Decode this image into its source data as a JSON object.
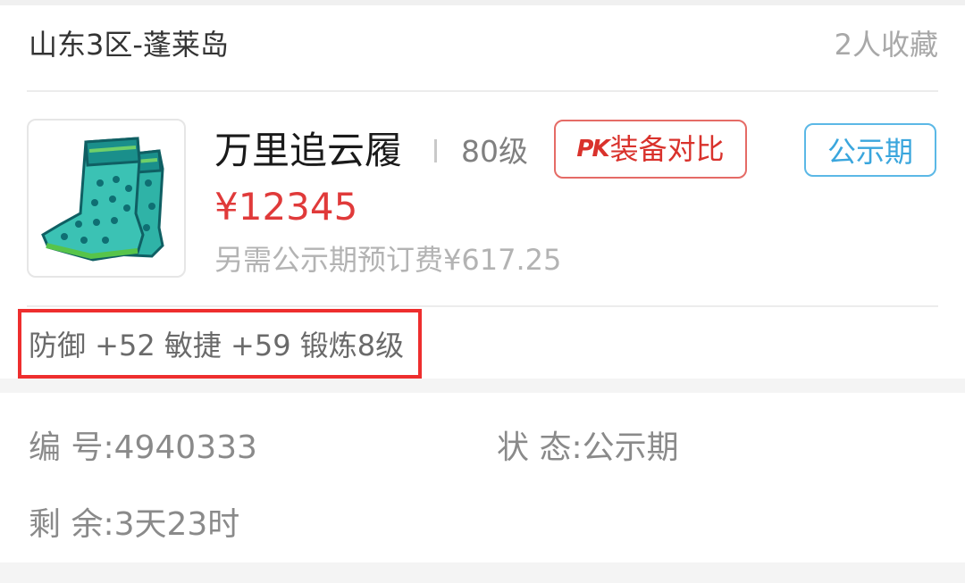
{
  "header": {
    "server": "山东3区-蓬莱岛",
    "favorites": "2人收藏"
  },
  "item": {
    "icon": "boots-icon",
    "name": "万里追云履",
    "level": "80级",
    "price": "¥12345",
    "fee_note": "另需公示期预订费¥617.25",
    "attributes": "防御 +52 敏捷 +59 锻炼8级"
  },
  "buttons": {
    "pk_icon_text": "PK",
    "pk_compare_label": "装备对比"
  },
  "status_tag": "公示期",
  "details": {
    "serial_label": "编  号:",
    "serial_value": "4940333",
    "status_label": "状  态:",
    "status_value": "公示期",
    "remaining_label": "剩  余:",
    "remaining_value": "3天23时"
  },
  "colors": {
    "price": "#e03a3a",
    "pk_accent": "#d9322c",
    "status_accent": "#3aa6dd",
    "highlight_box": "#ee2e2e"
  }
}
